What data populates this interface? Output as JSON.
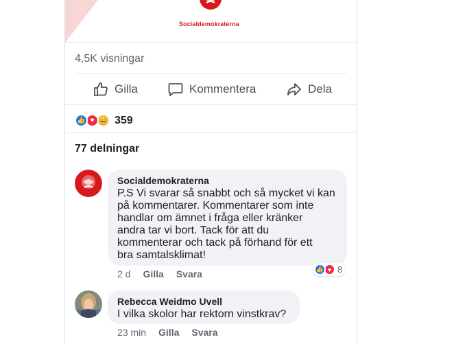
{
  "post": {
    "brand_name": "Socialdemokraterna",
    "views": "4,5K visningar",
    "reaction_count": "359",
    "shares": "77 delningar"
  },
  "actions": {
    "like": "Gilla",
    "comment": "Kommentera",
    "share": "Dela"
  },
  "comments": [
    {
      "author": "Socialdemokraterna",
      "lines": [
        "P.S Vi svarar så snabbt och så mycket vi kan",
        "på kommentarer. Kommentarer som inte",
        "handlar om ämnet i fråga eller kränker",
        "andra tar vi bort. Tack för att du",
        "kommenterar och tack på förhand för ett",
        "bra samtalsklimat!"
      ],
      "time": "2 d",
      "like": "Gilla",
      "reply": "Svara",
      "reaction_count": "8"
    },
    {
      "author": "Rebecca Weidmo Uvell",
      "lines": [
        "I vilka skolor har rektorn vinstkrav?"
      ],
      "time": "23 min",
      "like": "Gilla",
      "reply": "Svara"
    }
  ],
  "colors": {
    "accent": "#1877f2",
    "brand": "#d7191c",
    "love": "#f0284a"
  }
}
